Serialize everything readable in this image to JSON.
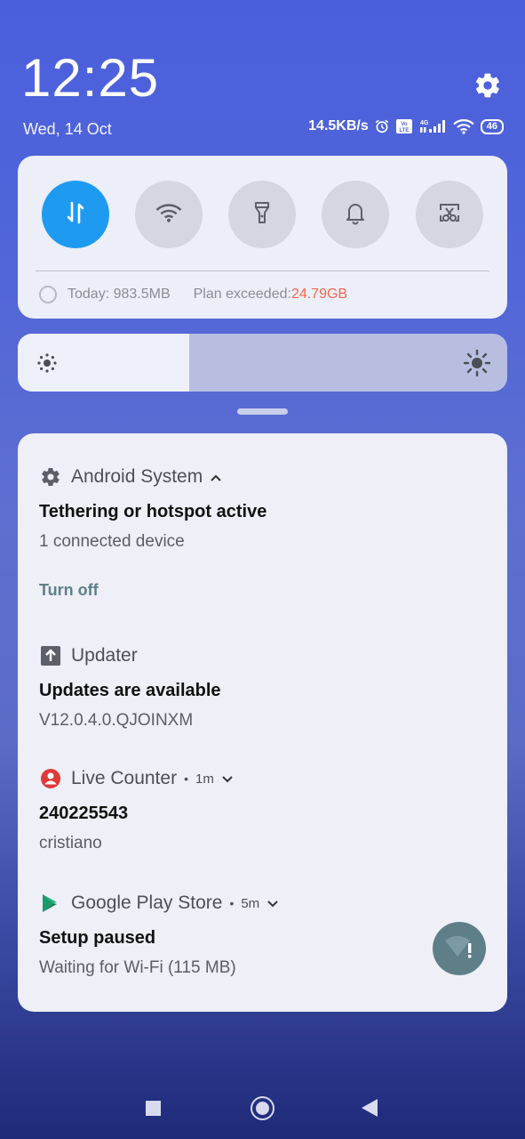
{
  "lockscreen": {
    "time": "12:25",
    "date": "Wed, 14 Oct"
  },
  "status_bar": {
    "net_speed": "14.5KB/s",
    "battery": "46",
    "icons": [
      "alarm-icon",
      "volte-icon",
      "4g-signal-icon",
      "wifi-icon",
      "battery-icon"
    ]
  },
  "quick_settings": {
    "toggles": [
      {
        "name": "mobile-data",
        "icon": "data-arrows-icon",
        "active": true
      },
      {
        "name": "wifi",
        "icon": "wifi-icon",
        "active": false
      },
      {
        "name": "flashlight",
        "icon": "flashlight-icon",
        "active": false
      },
      {
        "name": "sound",
        "icon": "bell-icon",
        "active": false
      },
      {
        "name": "screenshot",
        "icon": "scissors-icon",
        "active": false
      }
    ],
    "usage_today": "Today: 983.5MB",
    "plan_label": "Plan exceeded: ",
    "plan_value": "24.79GB"
  },
  "brightness": {
    "level": 0.35
  },
  "notifications": [
    {
      "app": "Android System",
      "title": "Tethering or hotspot active",
      "body": "1 connected device",
      "action": "Turn off"
    },
    {
      "app": "Updater",
      "title": "Updates are available",
      "body": "V12.0.4.0.QJOINXM"
    },
    {
      "app": "Live Counter",
      "time": "1m",
      "title": "240225543",
      "body": "cristiano"
    },
    {
      "app": "Google Play Store",
      "time": "5m",
      "title": "Setup paused",
      "body": "Waiting for Wi-Fi (115 MB)"
    }
  ],
  "colors": {
    "accent": "#1e9bf0",
    "warning": "#ef6a4f",
    "action": "#5e7f88",
    "live_counter": "#e03a3a",
    "play_store": "#1a9b6c"
  }
}
